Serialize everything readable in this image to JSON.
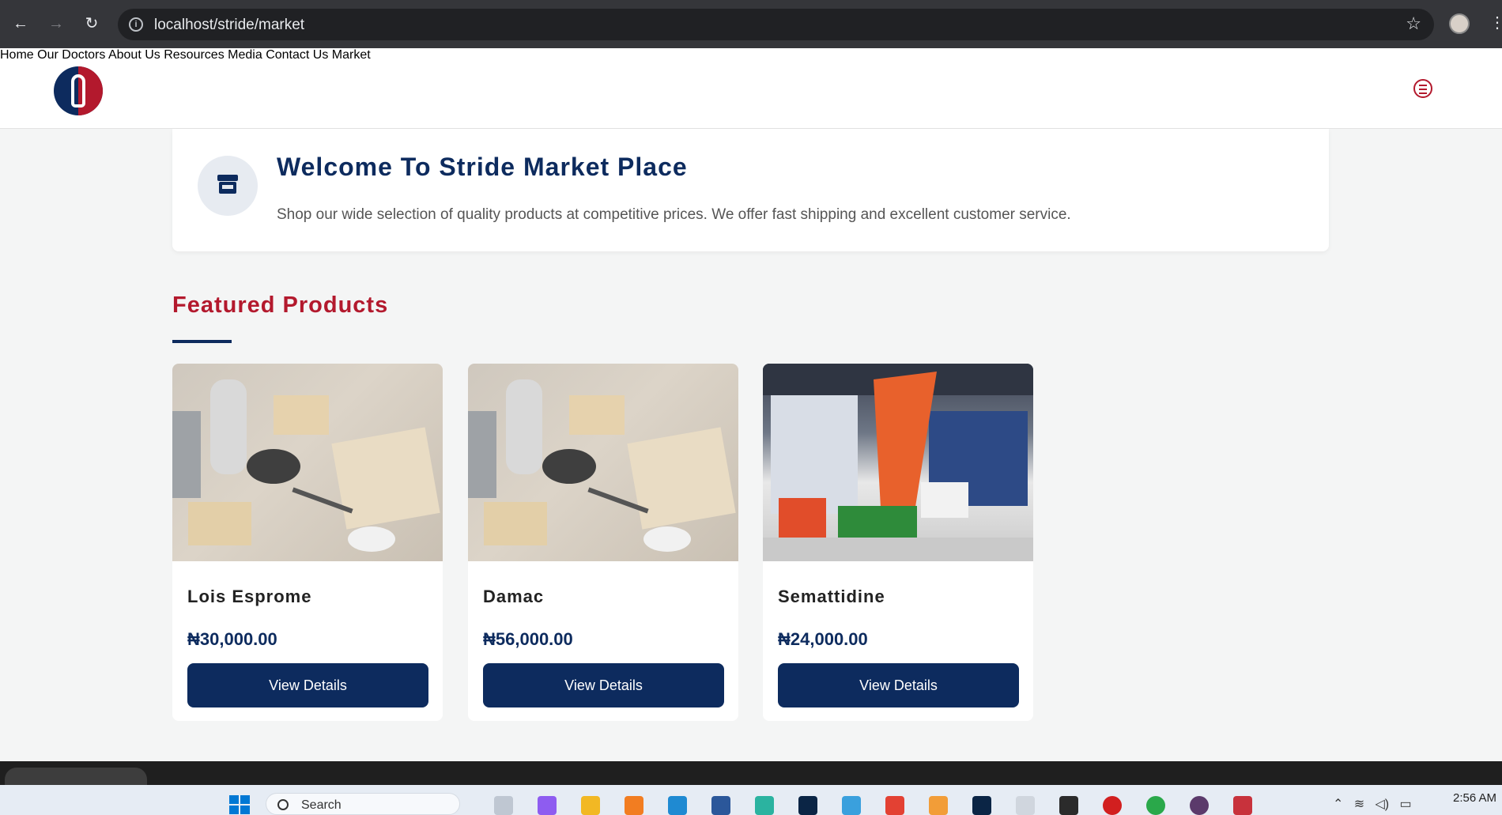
{
  "browser": {
    "url": "localhost/stride/market",
    "back_icon": "back-arrow-icon",
    "forward_icon": "forward-arrow-icon",
    "reload_icon": "reload-icon"
  },
  "site": {
    "nav": [
      "Home",
      "Our Doctors",
      "About Us",
      "Resources",
      "Media",
      "Contact Us",
      "Market"
    ],
    "brand_colors": {
      "navy": "#0d2b5e",
      "red": "#b3192d"
    }
  },
  "welcome": {
    "title": "Welcome To Stride Market Place",
    "text": "Shop our wide selection of quality products at competitive prices. We offer fast shipping and excellent customer service."
  },
  "featured": {
    "title": "Featured Products",
    "products": [
      {
        "name": "Lois Esprome",
        "price": "₦30,000.00",
        "button": "View Details",
        "image": "branded-merchandise-photo"
      },
      {
        "name": "Damac",
        "price": "₦56,000.00",
        "button": "View Details",
        "image": "branded-merchandise-photo"
      },
      {
        "name": "Semattidine",
        "price": "₦24,000.00",
        "button": "View Details",
        "image": "exhibition-booth-photo"
      }
    ]
  },
  "taskbar": {
    "search_label": "Search",
    "time": "2:56 AM"
  }
}
